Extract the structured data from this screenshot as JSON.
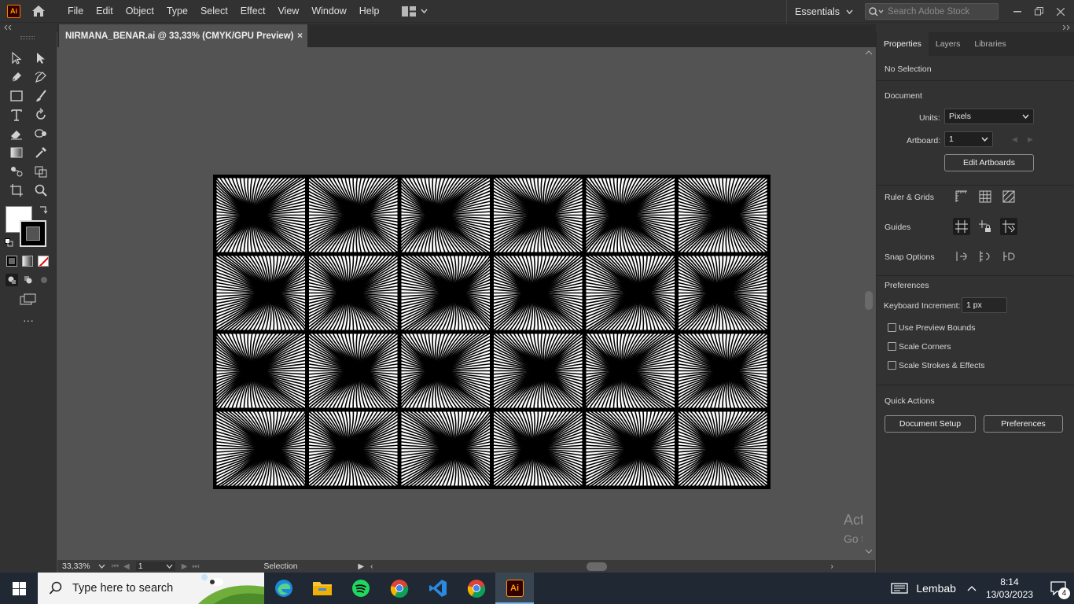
{
  "app": {
    "logo_text": "Ai",
    "menu": [
      "File",
      "Edit",
      "Object",
      "Type",
      "Select",
      "Effect",
      "View",
      "Window",
      "Help"
    ],
    "workspace": "Essentials",
    "search_placeholder": "Search Adobe Stock"
  },
  "document": {
    "tab_title": "NIRMANA_BENAR.ai @ 33,33% (CMYK/GPU Preview)",
    "close_glyph": "×",
    "zoom": "33,33%",
    "page": "1",
    "status_tool": "Selection"
  },
  "properties": {
    "tabs": [
      "Properties",
      "Layers",
      "Libraries"
    ],
    "selection": "No Selection",
    "document_header": "Document",
    "units_label": "Units:",
    "units_value": "Pixels",
    "artboard_label": "Artboard:",
    "artboard_value": "1",
    "edit_artboards": "Edit Artboards",
    "ruler_grids": "Ruler & Grids",
    "guides": "Guides",
    "snap_options": "Snap Options",
    "preferences_header": "Preferences",
    "keyboard_increment_label": "Keyboard Increment:",
    "keyboard_increment_value": "1 px",
    "use_preview_bounds": "Use Preview Bounds",
    "scale_corners": "Scale Corners",
    "scale_strokes": "Scale Strokes & Effects",
    "quick_actions": "Quick Actions",
    "document_setup": "Document Setup",
    "preferences_button": "Preferences"
  },
  "watermark": {
    "line1": "Activate Windows",
    "line2": "Go to Settings to activate Windows."
  },
  "taskbar": {
    "search_placeholder": "Type here to search",
    "weather": "Lembab",
    "time": "8:14",
    "date": "13/03/2023",
    "notifications": "4"
  }
}
